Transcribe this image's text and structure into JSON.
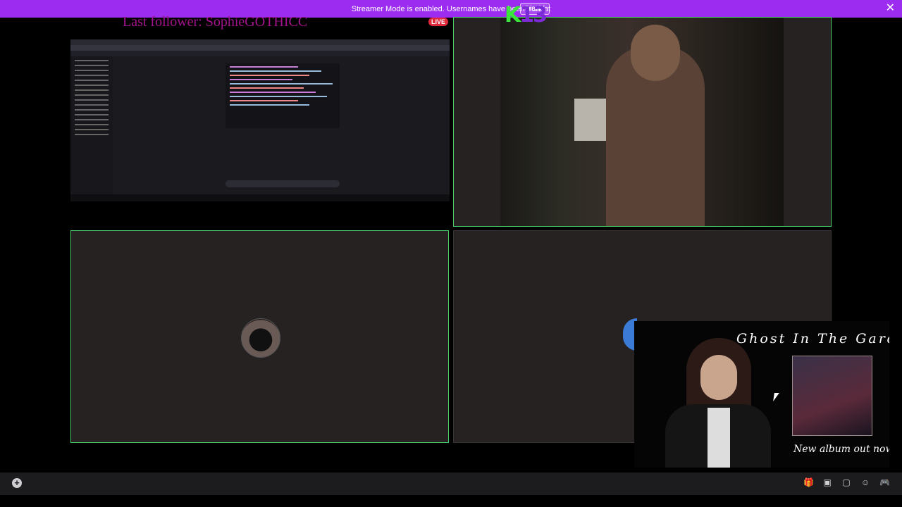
{
  "banner": {
    "message": "Streamer Mode is enabled. Usernames have been truncat",
    "button_label": "Disabl",
    "close_glyph": "✕"
  },
  "overlay": {
    "logo_k": "K",
    "logo_num": "13",
    "last_follower": "Last follower: SophieGOTHICC",
    "live_badge": "LIVE"
  },
  "album_ad": {
    "title": "Ghost In The Garden",
    "subtitle": "New album out now"
  },
  "bottom_bar": {
    "add_glyph": "+",
    "icons": [
      "gift-icon",
      "gif-icon",
      "sticker-icon",
      "emoji-icon",
      "activity-icon"
    ]
  }
}
